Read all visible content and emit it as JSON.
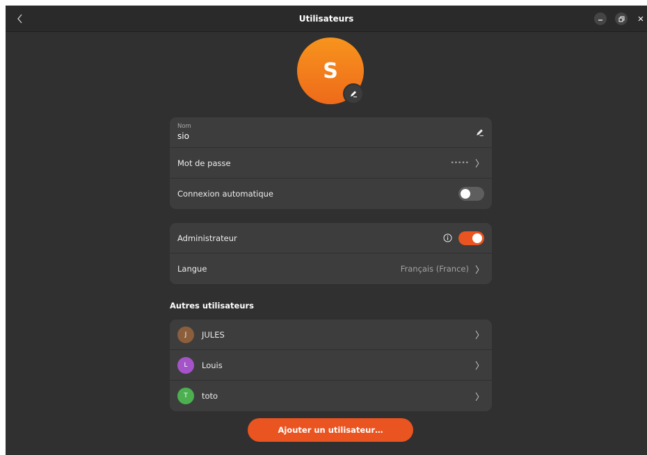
{
  "window": {
    "title": "Utilisateurs",
    "accent": "#e95420"
  },
  "avatar": {
    "letter": "S"
  },
  "account_card": {
    "name_caption": "Nom",
    "name_value": "sio",
    "password_label": "Mot de passe",
    "password_value": "•••••",
    "autologin_label": "Connexion automatique",
    "autologin_on": false
  },
  "settings_card": {
    "admin_label": "Administrateur",
    "admin_on": true,
    "language_label": "Langue",
    "language_value": "Français (France)"
  },
  "other_users": {
    "title": "Autres utilisateurs",
    "users": [
      {
        "initial": "J",
        "name": "JULES",
        "color": "#8b5e3c"
      },
      {
        "initial": "L",
        "name": "Louis",
        "color": "#a553c9"
      },
      {
        "initial": "T",
        "name": "toto",
        "color": "#4caf50"
      }
    ]
  },
  "add_user_label": "Ajouter un utilisateur…",
  "icons": [
    "back-icon",
    "minimize-icon",
    "restore-icon",
    "close-icon",
    "pencil-icon",
    "info-icon",
    "chevron-right-icon"
  ]
}
